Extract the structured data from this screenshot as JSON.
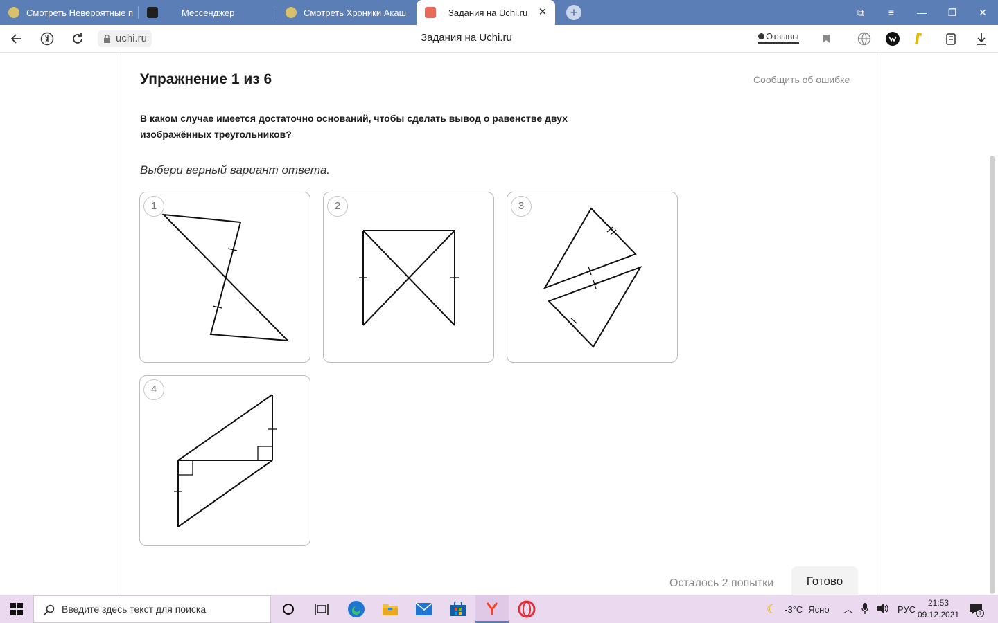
{
  "browser": {
    "tabs": [
      {
        "label": "Смотреть Невероятные п",
        "favicon_color": "#d8c16a"
      },
      {
        "label": "Мессенджер",
        "favicon_color": "#1f1f1f"
      },
      {
        "label": "Смотреть Хроники Акаш",
        "favicon_color": "#d8c16a"
      },
      {
        "label": "Задания на Uchi.ru",
        "favicon_color": "#e86a5a",
        "active": true
      }
    ],
    "new_tab_label": "+",
    "url": "uchi.ru",
    "page_title": "Задания на Uchi.ru",
    "reviews_label": "Отзывы"
  },
  "exercise": {
    "title": "Упражнение 1 из 6",
    "report_label": "Сообщить об ошибке",
    "question": "В каком случае имеется достаточно оснований, чтобы сделать вывод о равенстве двух изображённых треугольников?",
    "hint": "Выбери верный вариант ответа.",
    "options": [
      {
        "number": "1"
      },
      {
        "number": "2"
      },
      {
        "number": "3"
      },
      {
        "number": "4"
      }
    ],
    "attempts_label": "Осталось 2 попытки",
    "done_label": "Готово"
  },
  "taskbar": {
    "search_placeholder": "Введите здесь текст для поиска",
    "weather_temp": "-3°C",
    "weather_text": "Ясно",
    "language": "РУС",
    "time": "21:53",
    "date": "09.12.2021",
    "notification_count": "1"
  },
  "colors": {
    "tabbar": "#5c7eb6",
    "taskbar": "#ebd9f0",
    "accent_edge": "#1f76d2",
    "yandex_red": "#fc3f1d",
    "opera_red": "#e0303a"
  }
}
